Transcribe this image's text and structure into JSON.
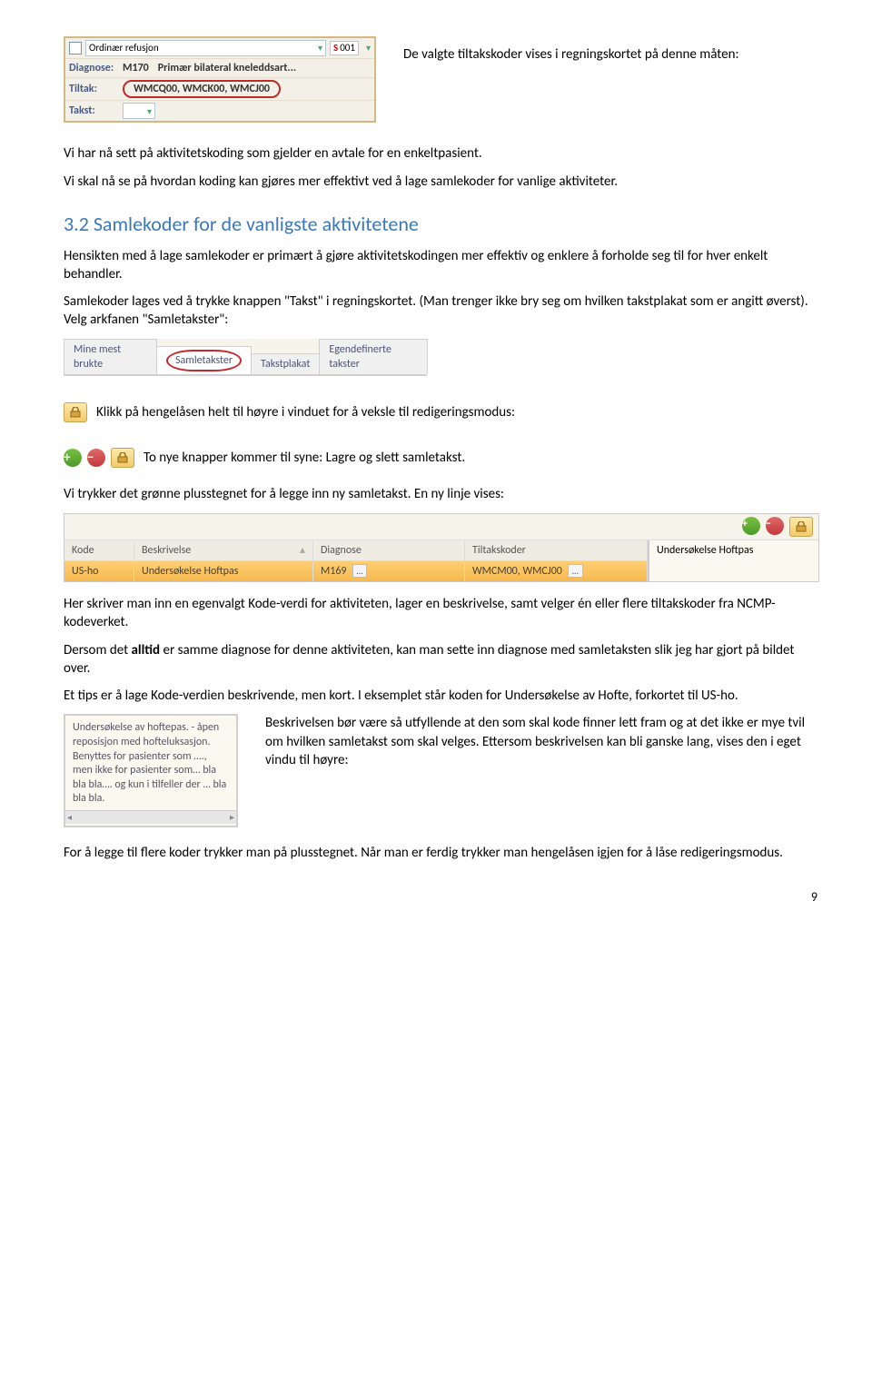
{
  "regn": {
    "refusjon_label": "Ordinær refusjon",
    "code_badge": "001",
    "diagnose_label": "Diagnose:",
    "diagnose_code": "M170",
    "diagnose_text": "Primær bilateral kneleddsart...",
    "tiltak_label": "Tiltak:",
    "tiltak_value": "WMCQ00, WMCK00, WMCJ00",
    "takst_label": "Takst:"
  },
  "p1": "De valgte tiltakskoder vises i regningskortet på denne måten:",
  "p2": "Vi har nå sett på aktivitetskoding som gjelder en avtale for en enkeltpasient.",
  "p3": "Vi skal nå se på hvordan koding kan gjøres mer effektivt ved å lage samlekoder for vanlige aktiviteter.",
  "sec_heading": "3.2    Samlekoder for de vanligste aktivitetene",
  "p4": "Hensikten med å lage samlekoder er primært å gjøre aktivitetskodingen mer effektiv og enklere å forholde seg til for hver enkelt behandler.",
  "p5": "Samlekoder lages ved å trykke knappen \"Takst\" i regningskortet. (Man trenger ikke bry seg om hvilken takstplakat som er angitt øverst). Velg arkfanen \"Samletakster\":",
  "tabs": {
    "t1": "Mine mest brukte",
    "t2": "Samletakster",
    "t3": "Takstplakat",
    "t4": "Egendefinerte takster"
  },
  "p6": "Klikk på hengelåsen helt til høyre i vinduet for å veksle til redigeringsmodus:",
  "p7": "To nye knapper kommer til syne: Lagre og slett samletakst.",
  "p8": "Vi trykker det grønne plusstegnet for å legge inn ny samletakst. En ny linje vises:",
  "table": {
    "h_kode": "Kode",
    "h_besk": "Beskrivelse",
    "h_diag": "Diagnose",
    "h_tilt": "Tiltakskoder",
    "side_label": "Undersøkelse Hoftpas",
    "r_kode": "US-ho",
    "r_besk": "Undersøkelse Hoftpas",
    "r_diag": "M169",
    "r_tilt": "WMCM00, WMCJ00"
  },
  "p9": "Her skriver man inn en egenvalgt Kode-verdi for aktiviteten, lager en beskrivelse, samt velger én eller flere tiltakskoder fra NCMP- kodeverket.",
  "p10a": "Dersom det ",
  "p10b": "alltid",
  "p10c": " er samme diagnose for denne aktiviteten, kan man sette inn diagnose med samletaksten slik jeg har gjort på bildet over.",
  "p11": "Et tips er å lage Kode-verdien beskrivende, men kort. I eksemplet står koden for Undersøkelse av Hofte, forkortet til US-ho.",
  "descbox": "Undersøkelse av hoftepas. - åpen reposisjon med hofteluksasjon. Benyttes for pasienter som …., men ikke for pasienter som… bla bla bla…. og kun i tilfeller der … bla bla bla.",
  "p12": "Beskrivelsen bør være så utfyllende at den som skal kode finner lett fram og at det ikke er mye tvil om hvilken samletakst som skal velges. Ettersom beskrivelsen kan bli ganske lang, vises den i eget vindu til høyre:",
  "p13": "For å legge til flere koder trykker man på plusstegnet. Når man er ferdig trykker man hengelåsen igjen for å låse redigeringsmodus.",
  "page_number": "9"
}
